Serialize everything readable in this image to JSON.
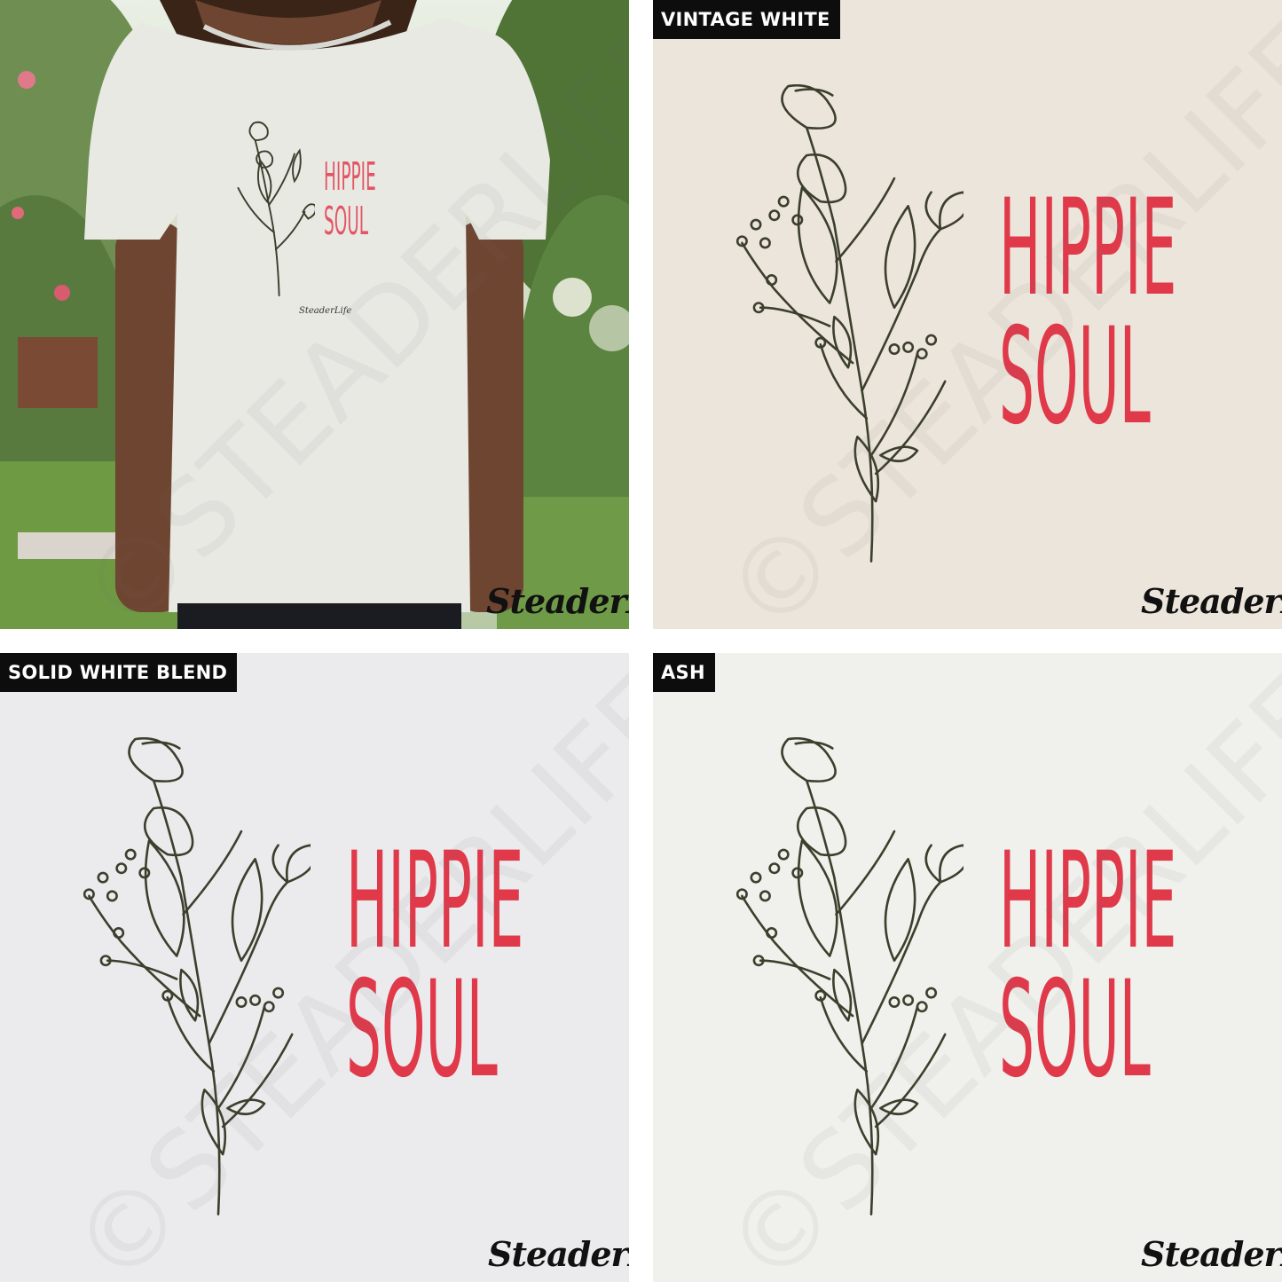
{
  "colors": {
    "accent_red": "#e0394a",
    "ink": "#3c3f2c",
    "vintage_white": "#ece5dc",
    "solid_white_blend": "#ebebed",
    "ash": "#f0f0ec"
  },
  "design": {
    "line1": "HIPPIE",
    "line2": "SOUL"
  },
  "brand": "SteaderLife",
  "watermark": "©STEADERLIFE",
  "panels": [
    {
      "label": ""
    },
    {
      "label": "VINTAGE WHITE"
    },
    {
      "label": "SOLID WHITE BLEND"
    },
    {
      "label": "ASH"
    }
  ],
  "icons": [
    "floral-sprig-icon",
    "brand-logo"
  ]
}
